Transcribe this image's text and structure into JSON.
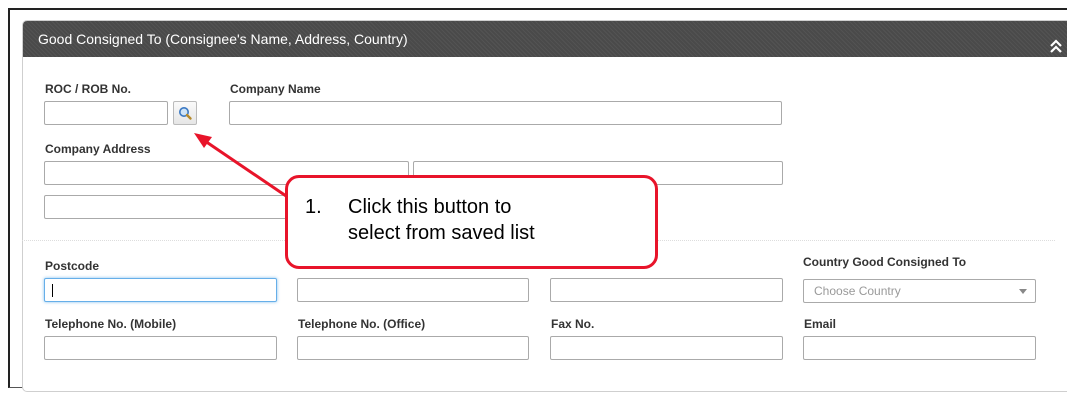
{
  "panel": {
    "title": "Good Consigned To (Consignee's Name, Address, Country)"
  },
  "form": {
    "roc_label": "ROC / ROB No.",
    "company_name_label": "Company Name",
    "company_address_label": "Company Address",
    "postcode_label": "Postcode",
    "country_label": "Country Good Consigned To",
    "country_placeholder": "Choose Country",
    "tel_mobile_label": "Telephone No. (Mobile)",
    "tel_office_label": "Telephone No. (Office)",
    "fax_label": "Fax No.",
    "email_label": "Email"
  },
  "callout": {
    "number": "1.",
    "line1": "Click this button to",
    "line2": "select from saved list"
  },
  "colors": {
    "header_bg": "#4a4a4a",
    "callout_border": "#e8142a",
    "arrow": "#e8142a",
    "focus_border": "#66afe9"
  },
  "icons": [
    "chevron-double-up-icon",
    "search-icon"
  ]
}
